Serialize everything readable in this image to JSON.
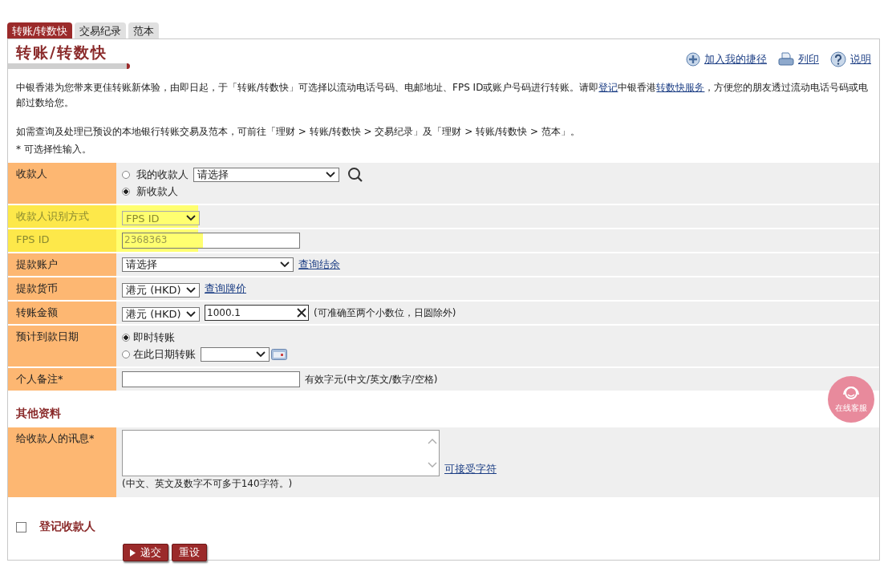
{
  "tabs": [
    {
      "label": "转账/转数快",
      "selected": true
    },
    {
      "label": "交易纪录",
      "selected": false
    },
    {
      "label": "范本",
      "selected": false
    }
  ],
  "page_title": "转账/转数快",
  "toolbar_links": [
    {
      "kind": "shortcut",
      "label": "加入我的捷径"
    },
    {
      "kind": "print",
      "label": "列印"
    },
    {
      "kind": "help",
      "label": "说明"
    }
  ],
  "intro": {
    "before": "中银香港为您带来更佳转账新体验，由即日起，于「转账/转数快」可选择以流动电话号码、电邮地址、FPS ID或账户号码进行转账。请即",
    "link1": "登记",
    "middle": "中银香港",
    "link2": "转数快服务",
    "after": "，方便您的朋友透过流动电话号码或电邮过数给您。"
  },
  "note": "如需查询及处理已预设的本地银行转账交易及范本，可前往「理财 > 转账/转数快 > 交易纪录」及「理财 > 转账/转数快 > 范本」。",
  "optional_hint": "* 可选择性输入。",
  "rows": [
    {
      "kind": "payee",
      "label": "收款人",
      "highlighted": false,
      "options": [
        {
          "label": "我的收款人",
          "selected": false,
          "select": "请选择"
        },
        {
          "label": "新收款人",
          "selected": true
        }
      ]
    },
    {
      "kind": "select",
      "label": "收款人识别方式",
      "highlighted": true,
      "select": "FPS ID"
    },
    {
      "kind": "input",
      "label": "FPS ID",
      "highlighted": true,
      "value": "2368363"
    },
    {
      "kind": "wide_select",
      "label": "提款账户",
      "highlighted": false,
      "select": "请选择",
      "link": "查询结余"
    },
    {
      "kind": "select",
      "label": "提款货币",
      "highlighted": false,
      "select": "港元 (HKD)",
      "link": "查询牌价"
    },
    {
      "kind": "amount",
      "label": "转账金额",
      "highlighted": false,
      "select": "港元 (HKD)",
      "value": "1000.1",
      "note": "(可准确至两个小数位，日圆除外)"
    },
    {
      "kind": "date",
      "label": "预计到款日期",
      "highlighted": false,
      "options": [
        {
          "label": "即时转账",
          "selected": true
        },
        {
          "label": "在此日期转账",
          "selected": false
        }
      ]
    },
    {
      "kind": "remark",
      "label": "个人备注*",
      "highlighted": false,
      "note": "有效字元(中文/英文/数字/空格)"
    }
  ],
  "section_title": "其他资料",
  "message": {
    "label": "给收款人的讯息*",
    "hint": "(中文、英文及数字不可多于140字符。)",
    "link": "可接受字符"
  },
  "register": {
    "label": "登记收款人",
    "checked": false
  },
  "buttons": [
    {
      "kind": "submit",
      "label": "递交"
    },
    {
      "kind": "reset",
      "label": "重设"
    }
  ],
  "chat_button": "在线客服"
}
